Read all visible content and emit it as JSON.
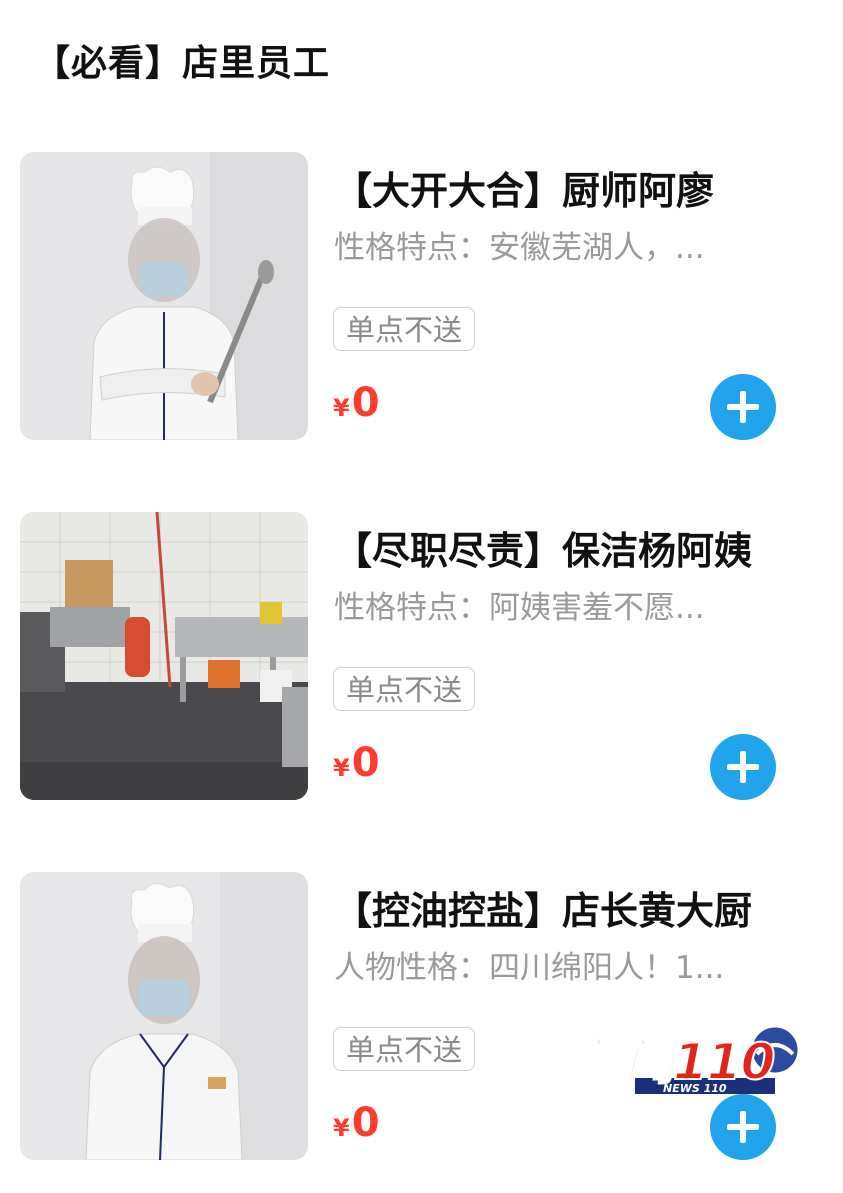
{
  "section": {
    "title": "【必看】店里员工"
  },
  "items": [
    {
      "name": "【大开大合】厨师阿廖",
      "desc": "性格特点：安徽芜湖人，...",
      "tag": "单点不送",
      "currency": "¥",
      "price": "0",
      "image": "chef-photo"
    },
    {
      "name": "【尽职尽责】保洁杨阿姨",
      "desc": "性格特点：阿姨害羞不愿...",
      "tag": "单点不送",
      "currency": "¥",
      "price": "0",
      "image": "kitchen-photo"
    },
    {
      "name": "【控油控盐】店长黄大厨",
      "desc": "人物性格：四川绵阳人！1...",
      "tag": "单点不送",
      "currency": "¥",
      "price": "0",
      "image": "chef-photo"
    }
  ],
  "watermark": {
    "text": "新闻110",
    "sub": "NEWS 110"
  },
  "colors": {
    "price": "#ff3b2f",
    "add_button": "#21a4ec",
    "desc": "#9a9a9a",
    "tag_border": "#cfcfcf"
  },
  "icons": {
    "add": "plus-icon"
  }
}
